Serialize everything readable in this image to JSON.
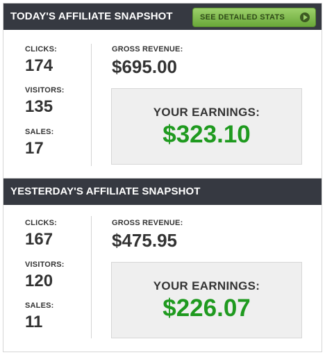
{
  "today": {
    "title": "TODAY'S AFFILIATE SNAPSHOT",
    "stats_button": "SEE DETAILED STATS",
    "clicks_label": "CLICKS:",
    "clicks": "174",
    "visitors_label": "VISITORS:",
    "visitors": "135",
    "sales_label": "SALES:",
    "sales": "17",
    "gross_label": "GROSS REVENUE:",
    "gross": "$695.00",
    "earnings_label": "YOUR EARNINGS:",
    "earnings": "$323.10"
  },
  "yesterday": {
    "title": "YESTERDAY'S AFFILIATE SNAPSHOT",
    "clicks_label": "CLICKS:",
    "clicks": "167",
    "visitors_label": "VISITORS:",
    "visitors": "120",
    "sales_label": "SALES:",
    "sales": "11",
    "gross_label": "GROSS REVENUE:",
    "gross": "$475.95",
    "earnings_label": "YOUR EARNINGS:",
    "earnings": "$226.07"
  },
  "colors": {
    "header_bg": "#363941",
    "button_green": "#8cc45a",
    "earnings_green": "#1f9a1f"
  },
  "icons": {
    "stats_button": "play-circle-icon"
  }
}
